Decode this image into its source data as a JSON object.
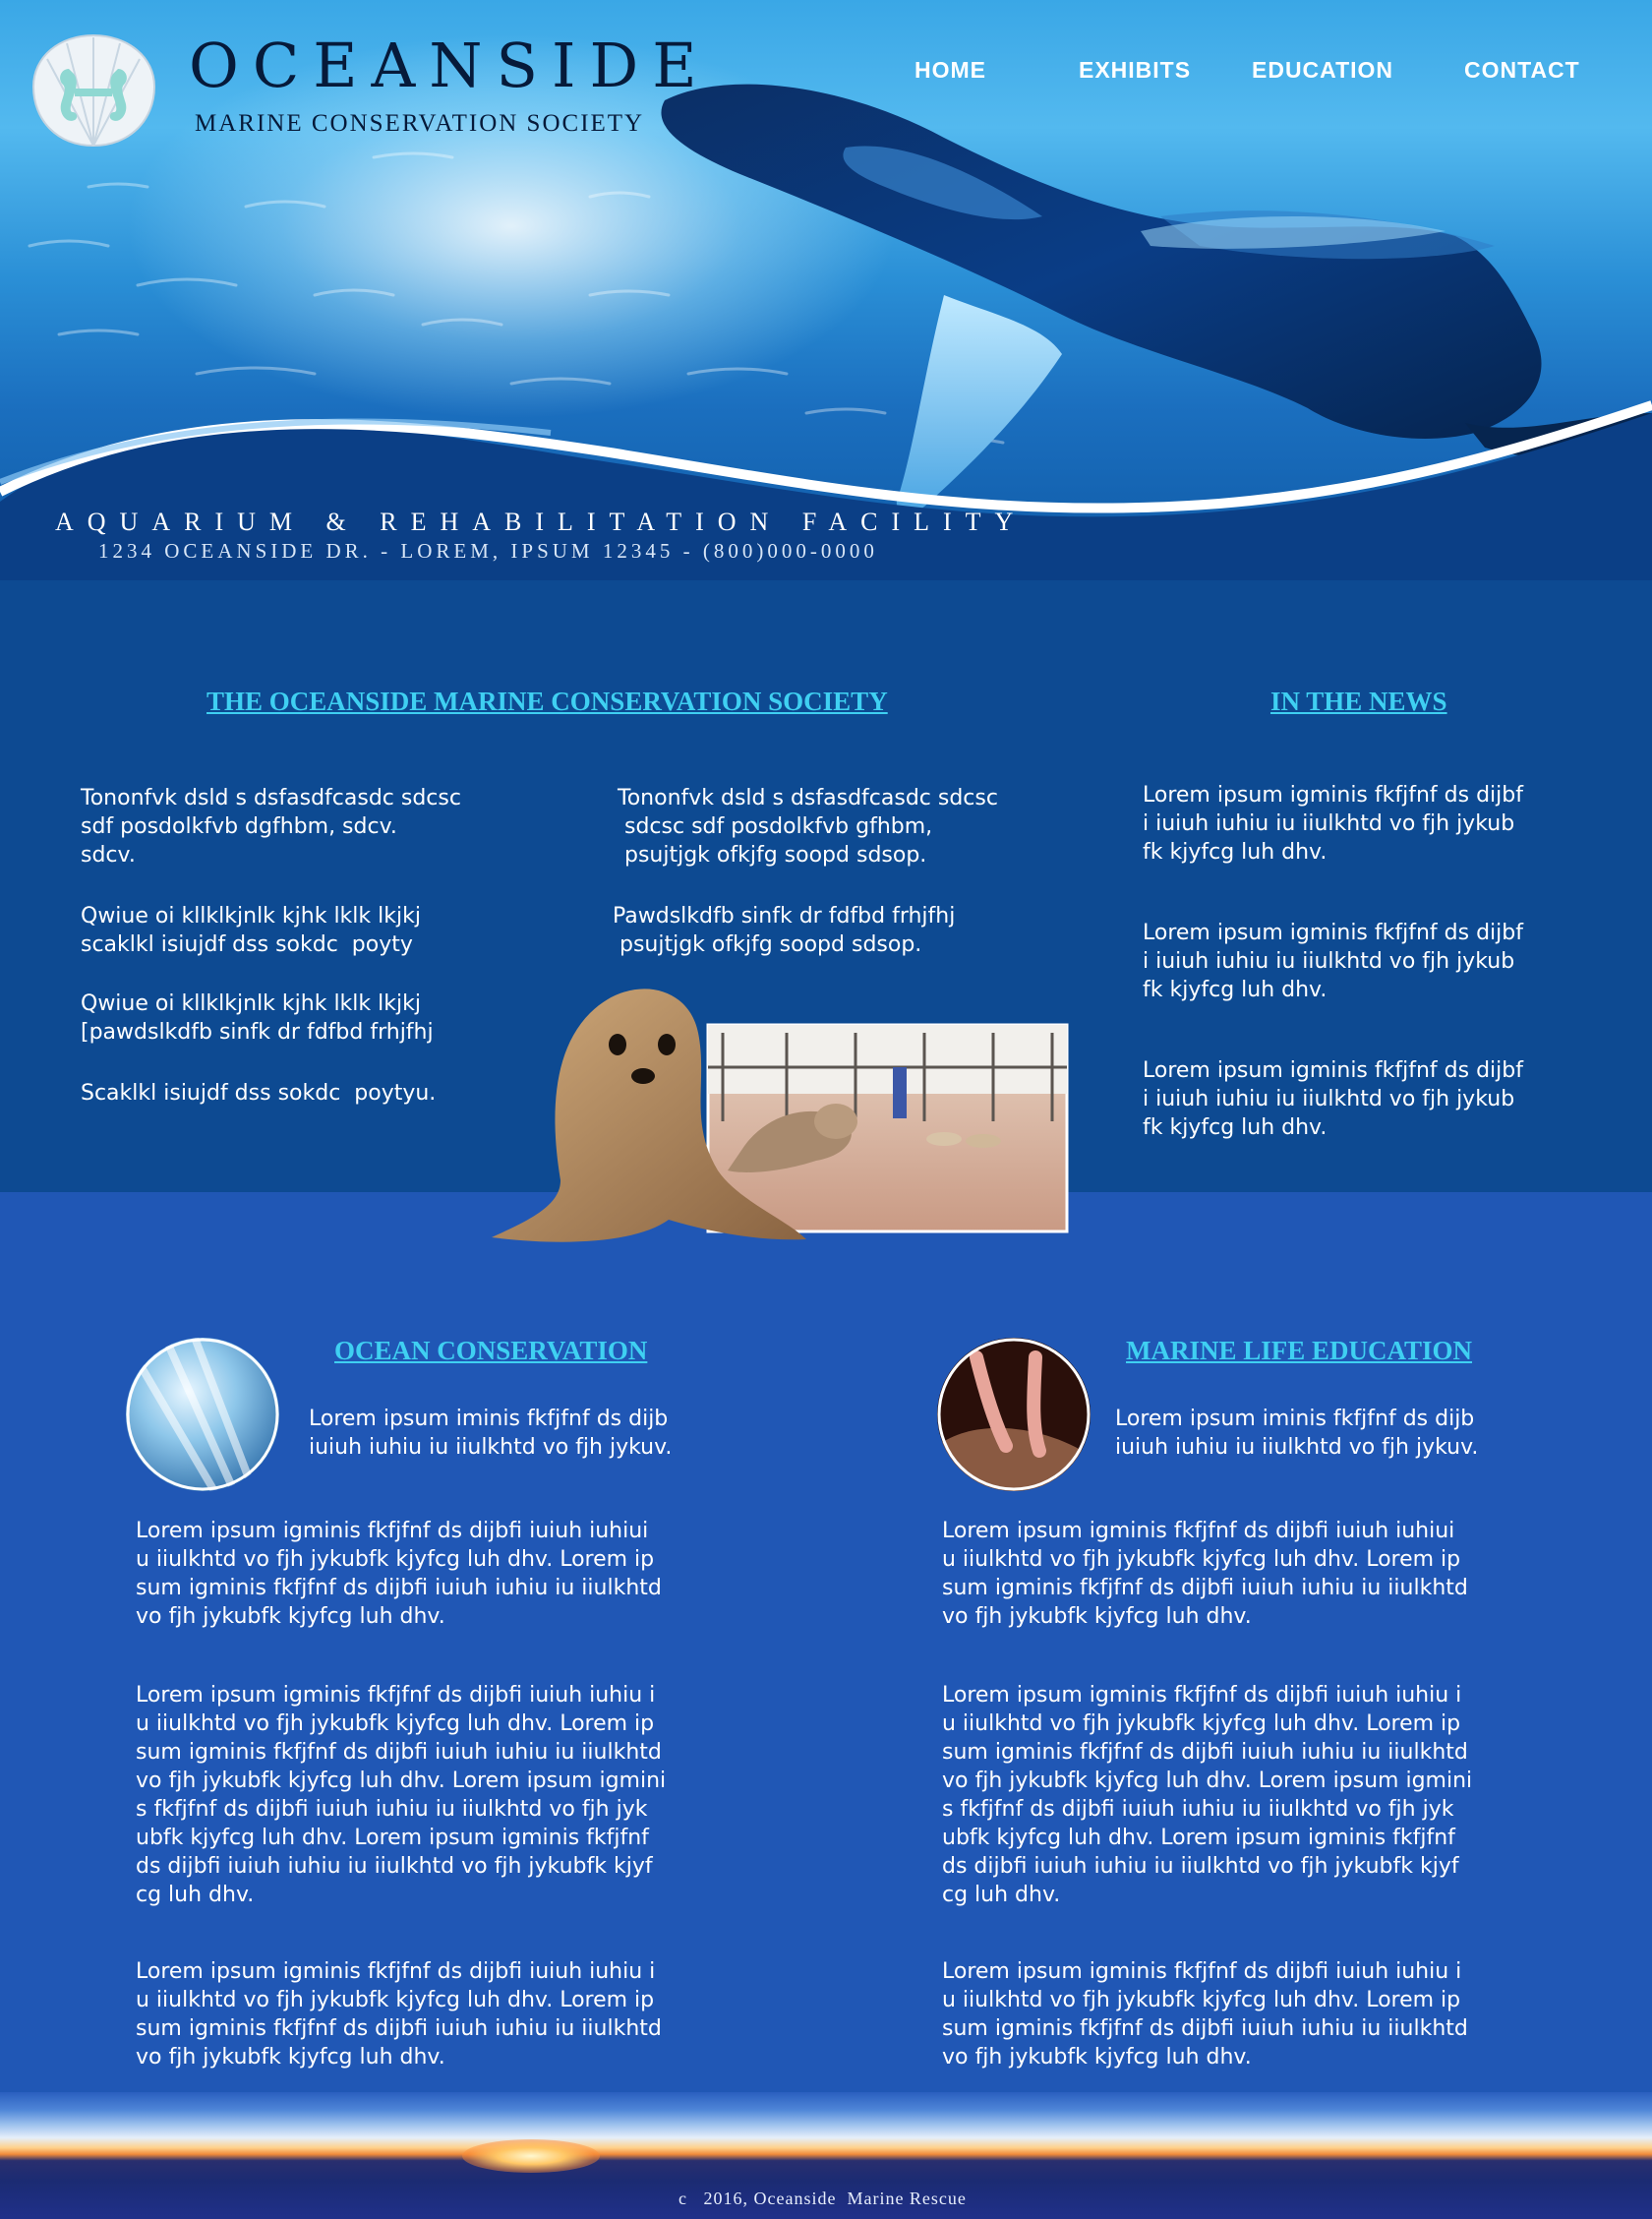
{
  "brand": {
    "title": "OCEANSIDE",
    "subtitle": "MARINE CONSERVATION SOCIETY"
  },
  "nav": {
    "items": [
      {
        "label": "HOME"
      },
      {
        "label": "EXHIBITS"
      },
      {
        "label": "EDUCATION"
      },
      {
        "label": "CONTACT"
      }
    ]
  },
  "hero": {
    "tagline": "AQUARIUM  &  REHABILITATION  FACILITY",
    "address": "1234 OCEANSIDE DR. - LOREM, IPSUM 12345 - (800)000-0000"
  },
  "about": {
    "heading": "THE OCEANSIDE MARINE CONSERVATION SOCIETY ",
    "col1": [
      "Tononfvk dsld s dsfasdfcasdc sdcsc\nsdf posdolkfvb dgfhbm, sdcv.\nsdcv.",
      "Qwiue oi kllklkjnlk kjhk lklk lkjkj\nscaklkl isiujdf dss sokdc  poyty",
      "Qwiue oi kllklkjnlk kjhk lklk lkjkj\n[pawdslkdfb sinfk dr fdfbd frhjfhj",
      "Scaklkl isiujdf dss sokdc  poytyu."
    ],
    "col2": [
      "Tononfvk dsld s dsfasdfcasdc sdcsc\n sdcsc sdf posdolkfvb gfhbm,\n psujtjgk ofkjfg soopd sdsop.",
      "Pawdslkdfb sinfk dr fdfbd frhjfhj\n psujtjgk ofkjfg soopd sdsop."
    ]
  },
  "news": {
    "heading": "IN THE NEWS",
    "items": [
      "Lorem ipsum igminis fkfjfnf ds dijbf\ni iuiuh iuhiu iu iiulkhtd vo fjh jykub\nfk kjyfcg luh dhv.",
      "Lorem ipsum igminis fkfjfnf ds dijbf\ni iuiuh iuhiu iu iiulkhtd vo fjh jykub\nfk kjyfcg luh dhv.",
      "Lorem ipsum igminis fkfjfnf ds dijbf\ni iuiuh iuhiu iu iiulkhtd vo fjh jykub\nfk kjyfcg luh dhv."
    ]
  },
  "conservation": {
    "heading": "OCEAN CONSERVATION",
    "intro": "Lorem ipsum iminis fkfjfnf ds dijb\niuiuh iuhiu iu iiulkhtd vo fjh jykuv.",
    "paragraphs": [
      "Lorem ipsum igminis fkfjfnf ds dijbfi iuiuh iuhiui\nu iiulkhtd vo fjh jykubfk kjyfcg luh dhv. Lorem ip\nsum igminis fkfjfnf ds dijbfi iuiuh iuhiu iu iiulkhtd\nvo fjh jykubfk kjyfcg luh dhv.",
      "Lorem ipsum igminis fkfjfnf ds dijbfi iuiuh iuhiu i\nu iiulkhtd vo fjh jykubfk kjyfcg luh dhv. Lorem ip\nsum igminis fkfjfnf ds dijbfi iuiuh iuhiu iu iiulkhtd\nvo fjh jykubfk kjyfcg luh dhv. Lorem ipsum igmini\ns fkfjfnf ds dijbfi iuiuh iuhiu iu iiulkhtd vo fjh jyk\nubfk kjyfcg luh dhv. Lorem ipsum igminis fkfjfnf\nds dijbfi iuiuh iuhiu iu iiulkhtd vo fjh jykubfk kjyf\ncg luh dhv.",
      "Lorem ipsum igminis fkfjfnf ds dijbfi iuiuh iuhiu i\nu iiulkhtd vo fjh jykubfk kjyfcg luh dhv. Lorem ip\nsum igminis fkfjfnf ds dijbfi iuiuh iuhiu iu iiulkhtd\nvo fjh jykubfk kjyfcg luh dhv."
    ]
  },
  "education": {
    "heading": "MARINE LIFE EDUCATION",
    "intro": "Lorem ipsum iminis fkfjfnf ds dijb\niuiuh iuhiu iu iiulkhtd vo fjh jykuv.",
    "paragraphs": [
      "Lorem ipsum igminis fkfjfnf ds dijbfi iuiuh iuhiui\nu iiulkhtd vo fjh jykubfk kjyfcg luh dhv. Lorem ip\nsum igminis fkfjfnf ds dijbfi iuiuh iuhiu iu iiulkhtd\nvo fjh jykubfk kjyfcg luh dhv.",
      "Lorem ipsum igminis fkfjfnf ds dijbfi iuiuh iuhiu i\nu iiulkhtd vo fjh jykubfk kjyfcg luh dhv. Lorem ip\nsum igminis fkfjfnf ds dijbfi iuiuh iuhiu iu iiulkhtd\nvo fjh jykubfk kjyfcg luh dhv. Lorem ipsum igmini\ns fkfjfnf ds dijbfi iuiuh iuhiu iu iiulkhtd vo fjh jyk\nubfk kjyfcg luh dhv. Lorem ipsum igminis fkfjfnf\nds dijbfi iuiuh iuhiu iu iiulkhtd vo fjh jykubfk kjyf\ncg luh dhv.",
      "Lorem ipsum igminis fkfjfnf ds dijbfi iuiuh iuhiu i\nu iiulkhtd vo fjh jykubfk kjyfcg luh dhv. Lorem ip\nsum igminis fkfjfnf ds dijbfi iuiuh iuhiu iu iiulkhtd\nvo fjh jykubfk kjyfcg luh dhv."
    ]
  },
  "footer": {
    "copyright": "c   2016, Oceanside  Marine Rescue"
  },
  "colors": {
    "heading_accent": "#3fd0f2",
    "top_section_bg": "#0d4a92",
    "bottom_section_bg": "#2057b5",
    "title_ink": "#061a3a"
  },
  "icons": {
    "logo": "seahorse-shell-icon",
    "hero_image": "humpback-whale",
    "feature_image": "sea-lion-pups-photo",
    "conservation_image": "underwater-light-rays-photo",
    "education_image": "hands-touching-ray-photo"
  }
}
